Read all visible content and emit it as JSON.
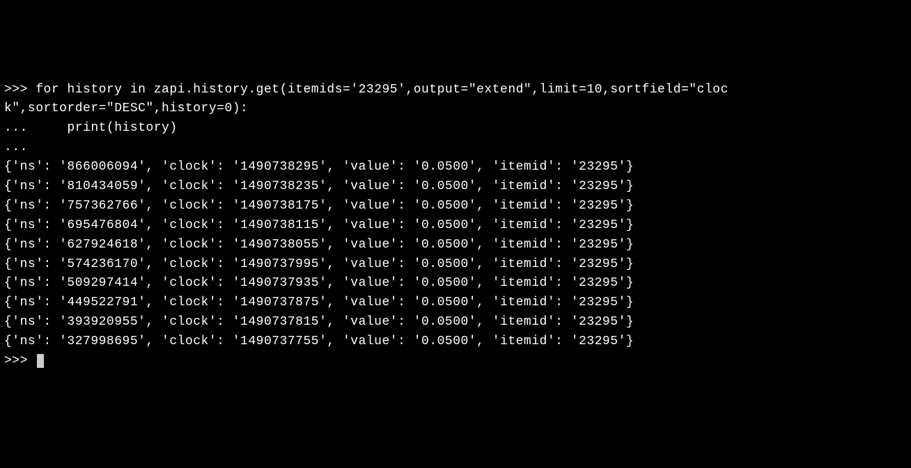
{
  "terminal": {
    "prompt_primary": ">>> ",
    "prompt_continuation": "... ",
    "command_line1": "for history in zapi.history.get(itemids='23295',output=\"extend\",limit=10,sortfield=\"cloc",
    "command_line2": "k\",sortorder=\"DESC\",history=0):",
    "command_line3": "    print(history)",
    "output_lines": [
      "{'ns': '866006094', 'clock': '1490738295', 'value': '0.0500', 'itemid': '23295'}",
      "{'ns': '810434059', 'clock': '1490738235', 'value': '0.0500', 'itemid': '23295'}",
      "{'ns': '757362766', 'clock': '1490738175', 'value': '0.0500', 'itemid': '23295'}",
      "{'ns': '695476804', 'clock': '1490738115', 'value': '0.0500', 'itemid': '23295'}",
      "{'ns': '627924618', 'clock': '1490738055', 'value': '0.0500', 'itemid': '23295'}",
      "{'ns': '574236170', 'clock': '1490737995', 'value': '0.0500', 'itemid': '23295'}",
      "{'ns': '509297414', 'clock': '1490737935', 'value': '0.0500', 'itemid': '23295'}",
      "{'ns': '449522791', 'clock': '1490737875', 'value': '0.0500', 'itemid': '23295'}",
      "{'ns': '393920955', 'clock': '1490737815', 'value': '0.0500', 'itemid': '23295'}",
      "{'ns': '327998695', 'clock': '1490737755', 'value': '0.0500', 'itemid': '23295'}"
    ]
  }
}
